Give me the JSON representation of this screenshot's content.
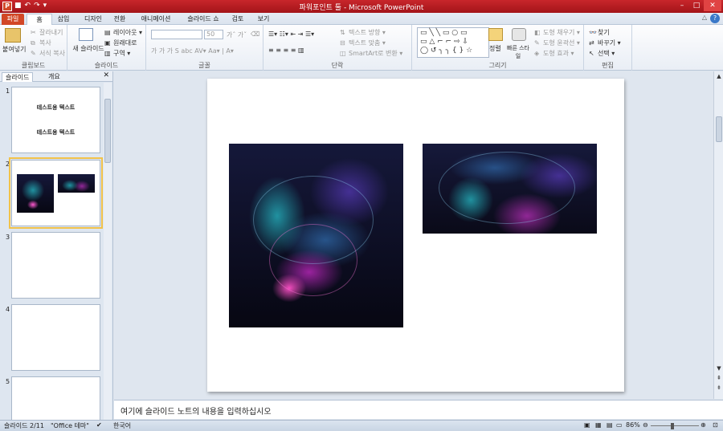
{
  "window": {
    "title": "파워포인트 툴 - Microsoft PowerPoint",
    "app_icon": "P"
  },
  "qat": [
    "save-icon",
    "undo-icon",
    "redo-icon",
    "customize-icon"
  ],
  "tabs": {
    "file": "파일",
    "items": [
      "홈",
      "삽입",
      "디자인",
      "전환",
      "애니메이션",
      "슬라이드 쇼",
      "검토",
      "보기"
    ],
    "active": "홈",
    "help": "?"
  },
  "ribbon": {
    "clipboard": {
      "label": "클립보드",
      "paste": "붙여넣기",
      "cut": "잘라내기",
      "copy": "복사",
      "format_painter": "서식 복사"
    },
    "slides": {
      "label": "슬라이드",
      "new_slide": "새 슬라이드",
      "layout": "레이아웃",
      "reset": "원래대로",
      "section": "구역"
    },
    "font": {
      "label": "글꼴",
      "size": "50"
    },
    "paragraph": {
      "label": "단락",
      "text_direction": "텍스트 방향",
      "align_text": "텍스트 맞춤",
      "smartart": "SmartArt로 변환"
    },
    "drawing": {
      "label": "그리기",
      "arrange": "정렬",
      "quick_styles": "빠른 스타일",
      "shape_fill": "도형 채우기",
      "shape_outline": "도형 윤곽선",
      "shape_effects": "도형 효과"
    },
    "editing": {
      "label": "편집",
      "find": "찾기",
      "replace": "바꾸기",
      "select": "선택"
    }
  },
  "left_panel": {
    "tabs": [
      "슬라이드",
      "개요"
    ],
    "slides": [
      {
        "num": "1",
        "lines": [
          "테스트용 텍스트",
          "테스트용 텍스트"
        ]
      },
      {
        "num": "2",
        "lines": []
      },
      {
        "num": "3",
        "lines": []
      },
      {
        "num": "4",
        "lines": []
      },
      {
        "num": "5",
        "lines": []
      }
    ]
  },
  "notes": {
    "placeholder": "여기에 슬라이드 노트의 내용을 입력하십시오"
  },
  "status": {
    "slide": "슬라이드 2/11",
    "theme": "\"Office 테마\"",
    "language": "한국어",
    "zoom": "86%"
  }
}
